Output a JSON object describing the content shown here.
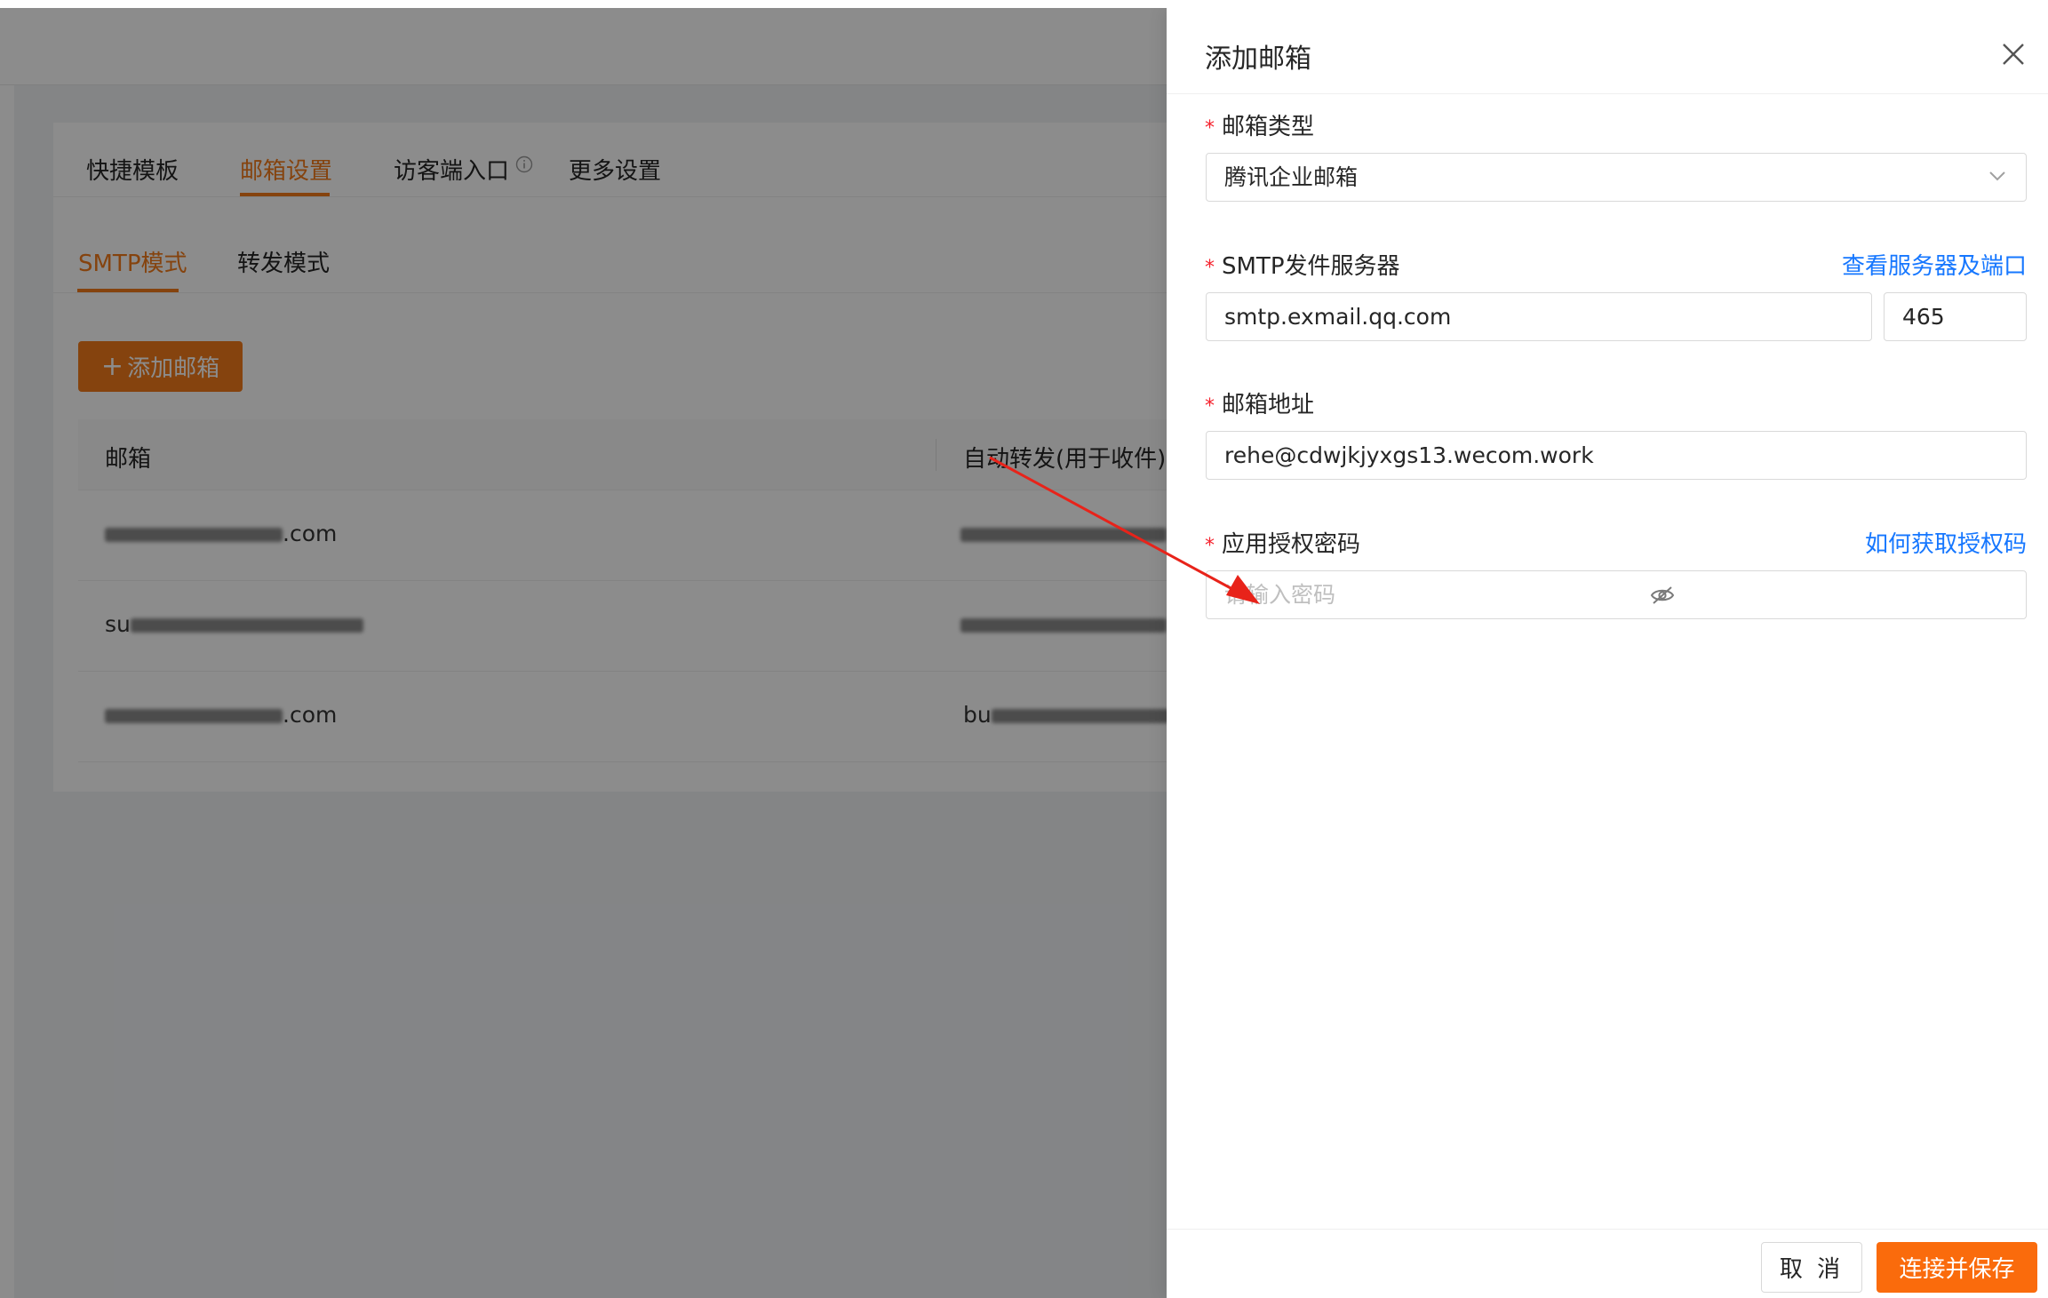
{
  "settings_page": {
    "tabs": [
      "快捷模板",
      "邮箱设置",
      "访客端入口",
      "更多设置"
    ],
    "active_tab": "邮箱设置",
    "mode_tabs": [
      "SMTP模式",
      "转发模式"
    ],
    "active_mode": "SMTP模式",
    "add_button": "添加邮箱",
    "table": {
      "columns": [
        "邮箱",
        "自动转发(用于收件)"
      ],
      "rows": [
        {
          "email_visible": ".com",
          "forward_visible": ""
        },
        {
          "email_visible": "su",
          "forward_visible": ""
        },
        {
          "email_visible": ".com",
          "forward_visible": "bu"
        }
      ]
    }
  },
  "drawer": {
    "title": "添加邮箱",
    "fields": {
      "mailbox_type": {
        "label": "邮箱类型",
        "value": "腾讯企业邮箱"
      },
      "smtp_server": {
        "label": "SMTP发件服务器",
        "link": "查看服务器及端口",
        "host": "smtp.exmail.qq.com",
        "port": "465"
      },
      "email_address": {
        "label": "邮箱地址",
        "value": "rehe@cdwjkjyxgs13.wecom.work"
      },
      "auth_password": {
        "label": "应用授权密码",
        "link": "如何获取授权码",
        "placeholder": "请输入密码"
      }
    },
    "buttons": {
      "cancel": "取 消",
      "save": "连接并保存"
    }
  },
  "colors": {
    "accent": "#f27a1a",
    "link": "#1677ff",
    "required": "#f5222d",
    "annotation_arrow": "#e8231a"
  }
}
